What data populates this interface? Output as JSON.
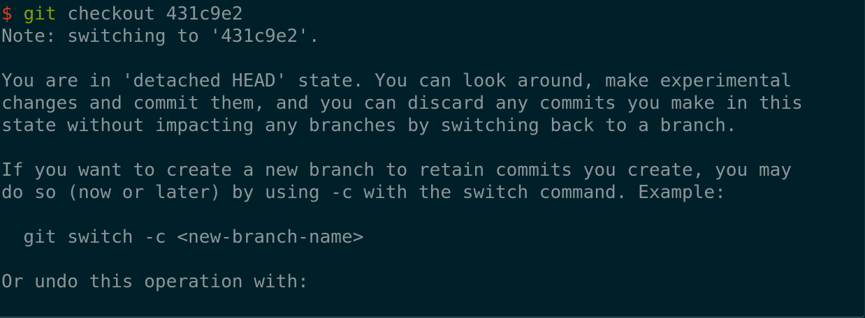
{
  "terminal": {
    "prompt": {
      "symbol": "$",
      "command": "git",
      "arguments": "checkout 431c9e2"
    },
    "output": [
      "Note: switching to '431c9e2'.",
      "",
      "You are in 'detached HEAD' state. You can look around, make experimental",
      "changes and commit them, and you can discard any commits you make in this",
      "state without impacting any branches by switching back to a branch.",
      "",
      "If you want to create a new branch to retain commits you create, you may",
      "do so (now or later) by using -c with the switch command. Example:",
      "",
      "  git switch -c <new-branch-name>",
      "",
      "Or undo this operation with:"
    ]
  },
  "colors": {
    "background": "#002029",
    "text": "#8a9699",
    "prompt_symbol": "#d3421c",
    "command": "#869b12"
  }
}
